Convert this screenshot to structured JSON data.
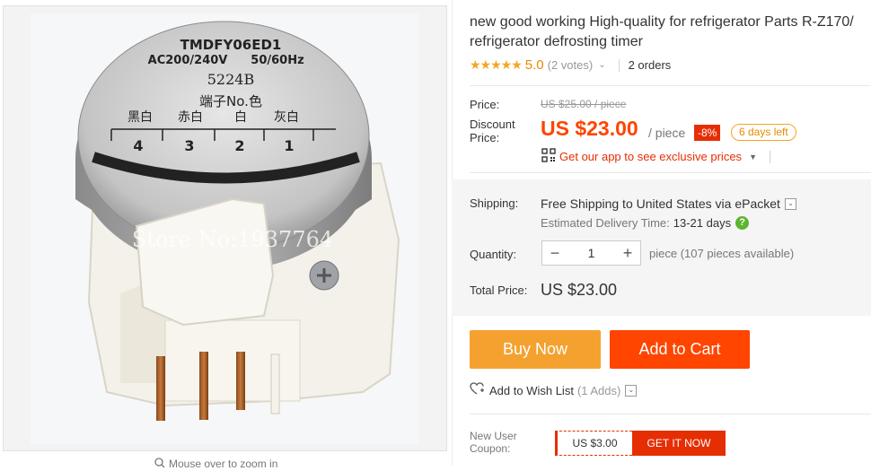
{
  "product_image": {
    "label_model": "TMDFY06ED1",
    "label_voltage": "AC200/240V",
    "label_freq": "50/60Hz",
    "label_code": "5224B",
    "label_terminal_title": "端子No.色",
    "label_colors": [
      "黑白",
      "赤白",
      "白",
      "灰白"
    ],
    "label_numbers": [
      "4",
      "3",
      "2",
      "1"
    ],
    "watermark": "Store No:1937764"
  },
  "zoom_hint": "Mouse over to zoom in",
  "title": {
    "line1": "new good working High-quality for refrigerator Parts R-Z170/",
    "line2": "refrigerator defrosting timer"
  },
  "rating": {
    "stars": "★★★★★",
    "value": "5.0",
    "votes": "(2 votes)",
    "orders": "2 orders"
  },
  "price": {
    "price_label": "Price:",
    "old_price": "US $25.00 / piece",
    "discount_label_1": "Discount",
    "discount_label_2": "Price:",
    "current": "US $23.00",
    "unit": "/ piece",
    "discount_badge": "-8%",
    "days_left": "6 days left",
    "app_promo": "Get our app to see exclusive prices"
  },
  "shipping": {
    "label": "Shipping:",
    "value": "Free Shipping to United States via ePacket",
    "estimate_label": "Estimated Delivery Time:",
    "estimate_value": "13-21 days"
  },
  "quantity": {
    "label": "Quantity:",
    "value": "1",
    "minus": "−",
    "plus": "+",
    "available": "piece (107 pieces available)"
  },
  "total": {
    "label": "Total Price:",
    "value": "US $23.00"
  },
  "actions": {
    "buy_now": "Buy Now",
    "add_to_cart": "Add to Cart",
    "wish_list": "Add to Wish List",
    "wish_count": "(1 Adds)"
  },
  "coupon": {
    "label_1": "New User",
    "label_2": "Coupon:",
    "amount": "US $3.00",
    "cta": "GET IT NOW"
  },
  "colors": {
    "accent_red": "#ff4400",
    "buy_orange": "#f5a12f",
    "cart_red": "#ff4500",
    "star": "#f5a623"
  }
}
